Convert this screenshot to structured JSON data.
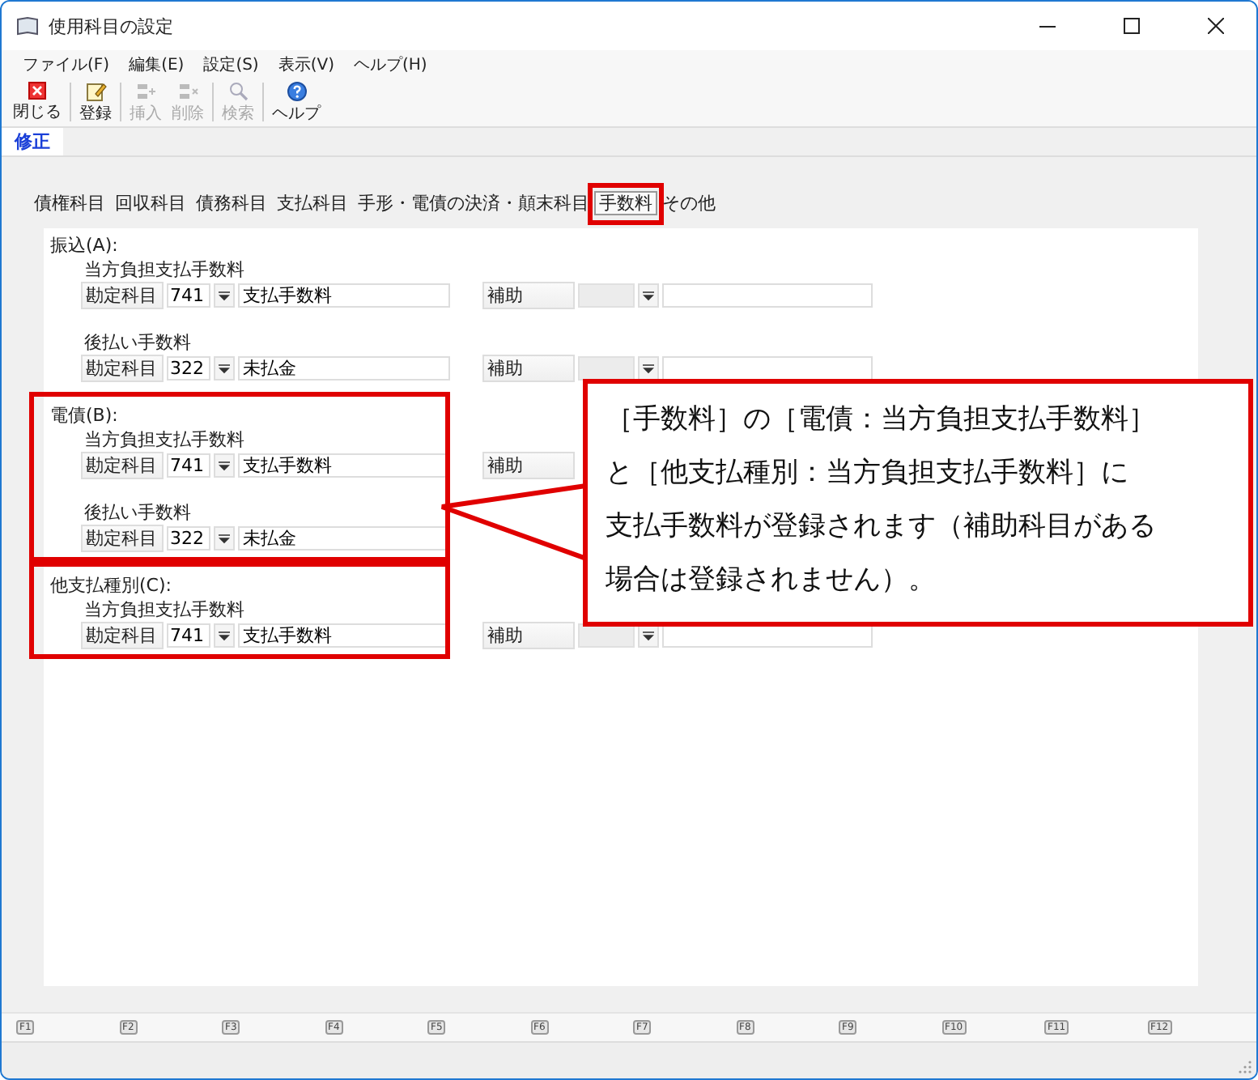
{
  "window": {
    "title": "使用科目の設定"
  },
  "menu": [
    "ファイル(F)",
    "編集(E)",
    "設定(S)",
    "表示(V)",
    "ヘルプ(H)"
  ],
  "toolbar": [
    {
      "kind": "close",
      "label": "閉じる",
      "disabled": false
    },
    {
      "kind": "register",
      "label": "登録",
      "disabled": false
    },
    {
      "kind": "insert",
      "label": "挿入",
      "disabled": true
    },
    {
      "kind": "delete",
      "label": "削除",
      "disabled": true
    },
    {
      "kind": "search",
      "label": "検索",
      "disabled": true
    },
    {
      "kind": "help",
      "label": "ヘルプ",
      "disabled": false
    }
  ],
  "mode_tab": "修正",
  "tabs": [
    {
      "label": "債権科目",
      "selected": false,
      "highlighted": false
    },
    {
      "label": "回収科目",
      "selected": false,
      "highlighted": false
    },
    {
      "label": "債務科目",
      "selected": false,
      "highlighted": false
    },
    {
      "label": "支払科目",
      "selected": false,
      "highlighted": false
    },
    {
      "label": "手形・電債の決済・顛末科目",
      "selected": false,
      "highlighted": false
    },
    {
      "label": "手数料",
      "selected": true,
      "highlighted": true
    },
    {
      "label": "その他",
      "selected": false,
      "highlighted": false
    }
  ],
  "sections": [
    {
      "label": "振込(A):",
      "highlighted": false,
      "groups": [
        {
          "title": "当方負担支払手数料",
          "row": {
            "label": "勘定科目",
            "code": "741",
            "name": "支払手数料",
            "sub": {
              "kind": "full",
              "label": "補助"
            }
          }
        },
        {
          "title": "後払い手数料",
          "row": {
            "label": "勘定科目",
            "code": "322",
            "name": "未払金",
            "sub": {
              "kind": "full",
              "label": "補助"
            }
          }
        }
      ]
    },
    {
      "label": "電債(B):",
      "highlighted": true,
      "groups": [
        {
          "title": "当方負担支払手数料",
          "row": {
            "label": "勘定科目",
            "code": "741",
            "name": "支払手数料",
            "sub": {
              "kind": "label_only",
              "label": "補助"
            }
          }
        },
        {
          "title": "後払い手数料",
          "row": {
            "label": "勘定科目",
            "code": "322",
            "name": "未払金"
          }
        }
      ]
    },
    {
      "label": "他支払種別(C):",
      "highlighted": true,
      "groups": [
        {
          "title": "当方負担支払手数料",
          "row": {
            "label": "勘定科目",
            "code": "741",
            "name": "支払手数料",
            "sub": {
              "kind": "full",
              "label": "補助"
            }
          }
        }
      ]
    }
  ],
  "callout": {
    "lines": [
      "［手数料］の［電債：当方負担支払手数料］",
      "と［他支払種別：当方負担支払手数料］に",
      "支払手数料が登録されます（補助科目がある",
      "場合は登録されません）。"
    ]
  },
  "function_keys": [
    "F1",
    "F2",
    "F3",
    "F4",
    "F5",
    "F6",
    "F7",
    "F8",
    "F9",
    "F10",
    "F11",
    "F12"
  ]
}
